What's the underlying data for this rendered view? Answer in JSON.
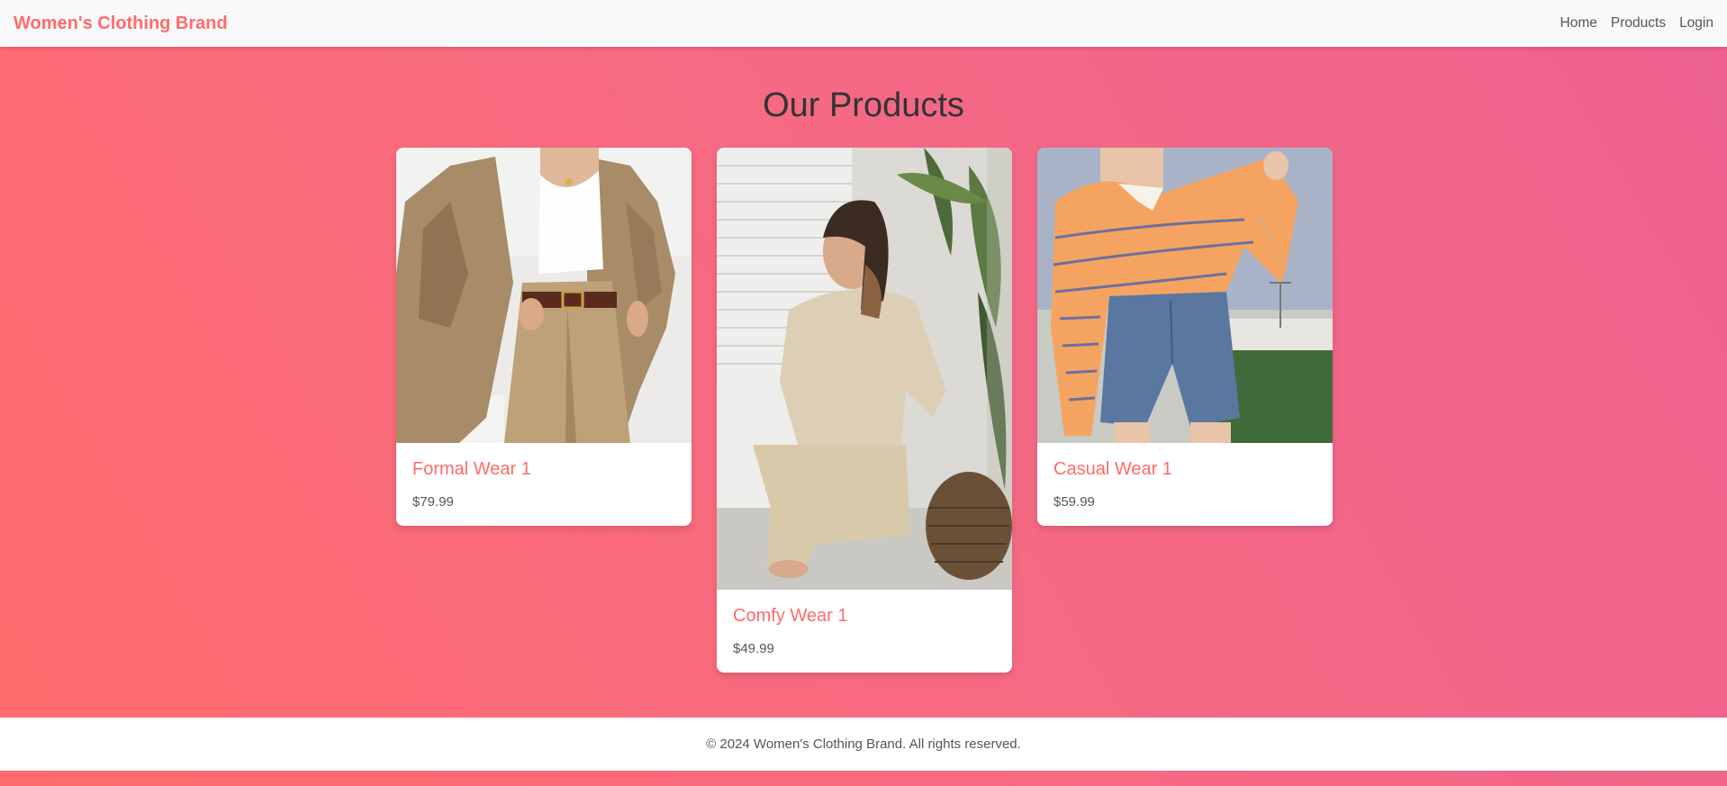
{
  "navbar": {
    "brand": "Women's Clothing Brand",
    "links": [
      "Home",
      "Products",
      "Login"
    ]
  },
  "main": {
    "title": "Our Products",
    "products": [
      {
        "name": "Formal Wear 1",
        "price": "$79.99",
        "image": "photo-woman-in-tan-suit"
      },
      {
        "name": "Comfy Wear 1",
        "price": "$49.99",
        "image": "photo-woman-in-knit-loungewear"
      },
      {
        "name": "Casual Wear 1",
        "price": "$59.99",
        "image": "photo-woman-in-striped-sweater"
      }
    ]
  },
  "footer": {
    "text": "© 2024 Women's Clothing Brand. All rights reserved."
  },
  "colors": {
    "accent": "#ff6b6b",
    "background_gradient_start": "#ff6b6b",
    "background_gradient_end": "#ee6190",
    "navbar_bg": "#f8f9fa",
    "text": "#555555"
  }
}
